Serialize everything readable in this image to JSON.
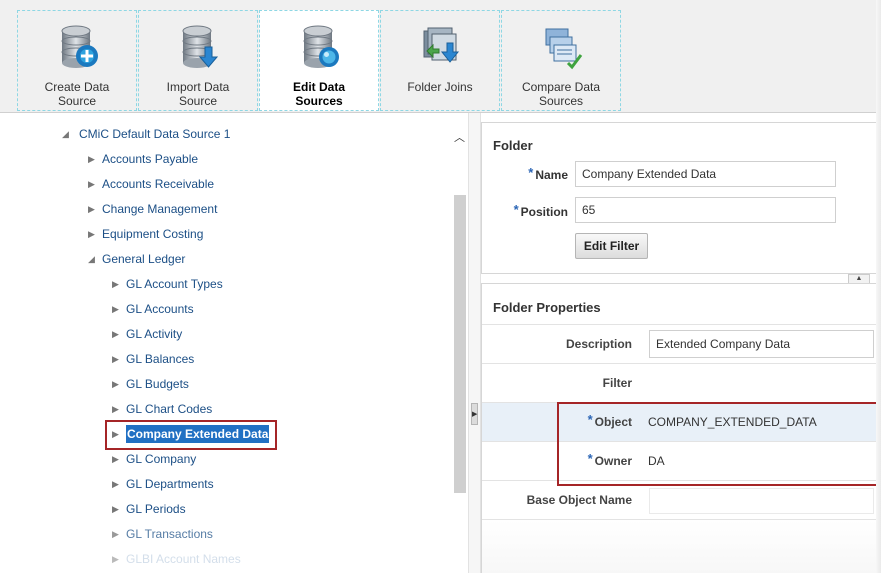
{
  "toolbar": {
    "tools": [
      {
        "label_line1": "Create Data",
        "label_line2": "Source",
        "icon": "create-data-source-icon"
      },
      {
        "label_line1": "Import Data",
        "label_line2": "Source",
        "icon": "import-data-source-icon"
      },
      {
        "label_line1": "Edit Data",
        "label_line2": "Sources",
        "icon": "edit-data-sources-icon",
        "active": true
      },
      {
        "label_line1": "Folder Joins",
        "label_line2": "",
        "icon": "folder-joins-icon"
      },
      {
        "label_line1": "Compare Data",
        "label_line2": "Sources",
        "icon": "compare-data-sources-icon"
      }
    ]
  },
  "tree": {
    "root": {
      "label": "CMiC Default Data Source 1",
      "expanded": true
    },
    "modules": [
      {
        "label": "Accounts Payable"
      },
      {
        "label": "Accounts Receivable"
      },
      {
        "label": "Change Management"
      },
      {
        "label": "Equipment Costing"
      },
      {
        "label": "General Ledger",
        "expanded": true
      }
    ],
    "gl_children": [
      {
        "label": "GL Account Types"
      },
      {
        "label": "GL Accounts"
      },
      {
        "label": "GL Activity"
      },
      {
        "label": "GL Balances"
      },
      {
        "label": "GL Budgets"
      },
      {
        "label": "GL Chart Codes"
      },
      {
        "label": "Company Extended Data",
        "selected": true
      },
      {
        "label": "GL Company"
      },
      {
        "label": "GL Departments"
      },
      {
        "label": "GL Periods"
      },
      {
        "label": "GL Transactions"
      },
      {
        "label": "GLBI Account Names"
      }
    ]
  },
  "folder": {
    "title": "Folder",
    "required_marker": "*",
    "name_label": "Name",
    "name_value": "Company Extended Data",
    "position_label": "Position",
    "position_value": "65",
    "edit_filter_label": "Edit Filter"
  },
  "properties": {
    "title": "Folder Properties",
    "description_label": "Description",
    "description_value": "Extended Company Data",
    "filter_label": "Filter",
    "filter_value": "",
    "object_label": "Object",
    "object_value": "COMPANY_EXTENDED_DATA",
    "owner_label": "Owner",
    "owner_value": "DA",
    "base_object_label": "Base Object Name",
    "base_object_value": ""
  },
  "colors": {
    "link": "#1c4f86",
    "selection": "#2170c3",
    "highlight_box": "#a52527",
    "required_marker": "#2b65b5",
    "toolbar_border": "#8ed7e4"
  }
}
